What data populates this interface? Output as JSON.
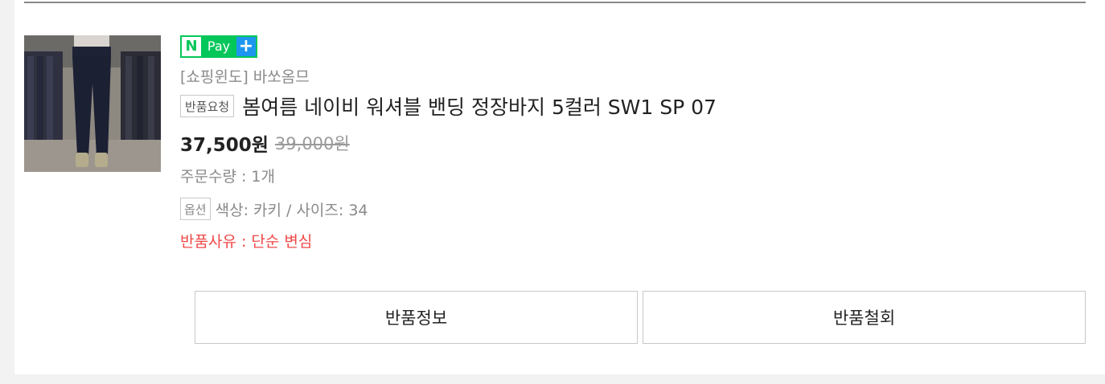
{
  "order_item": {
    "npay_badge": {
      "n": "N",
      "pay": "Pay",
      "plus": "+"
    },
    "store_name": "[쇼핑윈도] 바쏘옴므",
    "status_badge": "반품요청",
    "product_title": "봄여름 네이비 워셔블 밴딩 정장바지 5컬러 SW1 SP 07",
    "price": "37,500원",
    "original_price": "39,000원",
    "quantity_text": "주문수량 : 1개",
    "option_badge": "옵션",
    "option_text": "색상: 카키 / 사이즈: 34",
    "return_reason": "반품사유 : 단순 변심"
  },
  "actions": {
    "return_info_label": "반품정보",
    "return_cancel_label": "반품철회"
  },
  "colors": {
    "npay_green": "#03c75a",
    "npay_blue": "#1e96f0",
    "reason_red": "#f04848"
  },
  "images": {
    "product_thumbnail": "product-thumbnail-navy-pants"
  }
}
